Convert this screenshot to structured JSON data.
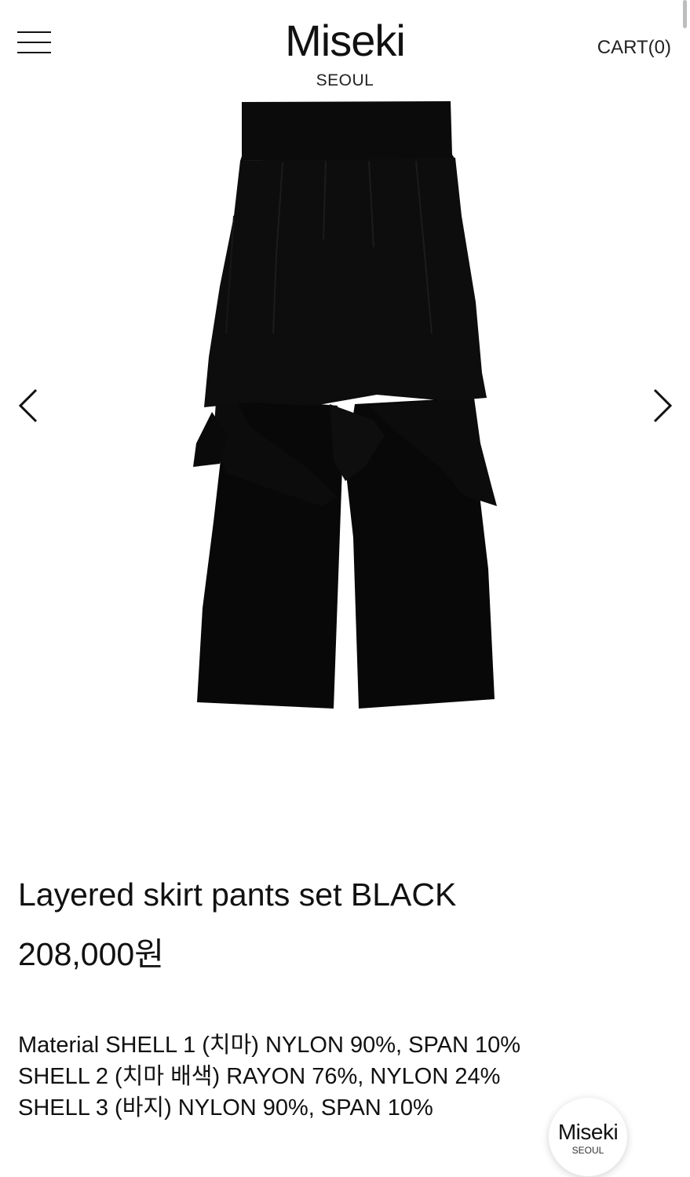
{
  "header": {
    "logo_main": "Miseki",
    "logo_sub": "SEOUL",
    "cart_label": "CART(0)"
  },
  "gallery": {
    "image_alt": "Layered skirt pants set BLACK",
    "prev_icon": "chevron-left-icon",
    "next_icon": "chevron-right-icon"
  },
  "product": {
    "title": "Layered skirt pants set BLACK",
    "price": "208,000원",
    "material": [
      "Material SHELL 1 (치마) NYLON 90%, SPAN 10%",
      "SHELL 2 (치마 배색) RAYON 76%, NYLON 24%",
      "SHELL 3 (바지) NYLON 90%, SPAN 10%"
    ]
  },
  "floating_logo": {
    "main": "Miseki",
    "sub": "SEOUL"
  },
  "colors": {
    "text": "#111111",
    "background": "#ffffff",
    "garment": "#0b0b0b"
  }
}
